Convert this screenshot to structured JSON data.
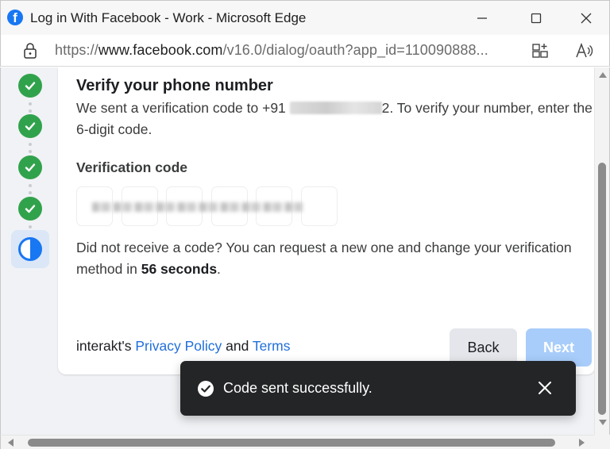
{
  "window": {
    "title": "Log in With Facebook - Work - Microsoft Edge",
    "logo_letter": "f",
    "url_prefix": "https://",
    "url_host": "www.facebook.com",
    "url_path": "/v16.0/dialog/oauth?app_id=110090888..."
  },
  "steps": {
    "completed_count": 4,
    "current_index": 5,
    "icons": [
      "check-icon",
      "check-icon",
      "check-icon",
      "check-icon",
      "half-circle-icon"
    ]
  },
  "dialog": {
    "heading": "Verify your phone number",
    "desc_before": "We sent a verification code to +91 ",
    "desc_after": "2. To verify your number, enter the 6-digit code.",
    "code_label": "Verification code",
    "code_box_count": 6,
    "resend_text": "Did not receive a code? You can request a new one and change your verification method in ",
    "resend_seconds": "56 seconds",
    "resend_end": ".",
    "policy_prefix": "interakt's ",
    "privacy_link": "Privacy Policy",
    "policy_and": " and ",
    "terms_link": "Terms",
    "back_label": "Back",
    "next_label": "Next"
  },
  "toast": {
    "message": "Code sent successfully."
  },
  "colors": {
    "facebook_blue": "#1877f2",
    "success_green": "#31a24c",
    "link_blue": "#216fdb",
    "next_disabled": "#a8cdfa",
    "toast_bg": "#242526"
  }
}
